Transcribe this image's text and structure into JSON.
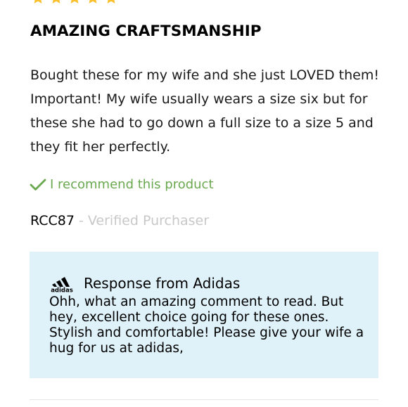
{
  "review": {
    "rating": 5,
    "rating_max": 5,
    "title": "AMAZING CRAFTSMANSHIP",
    "body": "Bought these for my wife and she just LOVED them! Important! My wife usually wears a size six but for these she had to go down a full size to a size 5 and they fit her perfectly.",
    "recommend_text": "I recommend this product",
    "reviewer_name": "RCC87",
    "verified_text": "- Verified Purchaser"
  },
  "response": {
    "title": "Response from Adidas",
    "brand_logo": "adidas-logo-icon",
    "body": "Ohh, what an amazing comment to read. But hey, excellent choice going for these ones. Stylish and comfortable! Please give your wife a hug for us at adidas,"
  },
  "colors": {
    "star": "#fbc02d",
    "recommend": "#6aa84f",
    "verified": "#c8c8c8",
    "response_background": "#dff1f9"
  },
  "icons": {
    "star": "star-icon",
    "check": "check-icon"
  }
}
